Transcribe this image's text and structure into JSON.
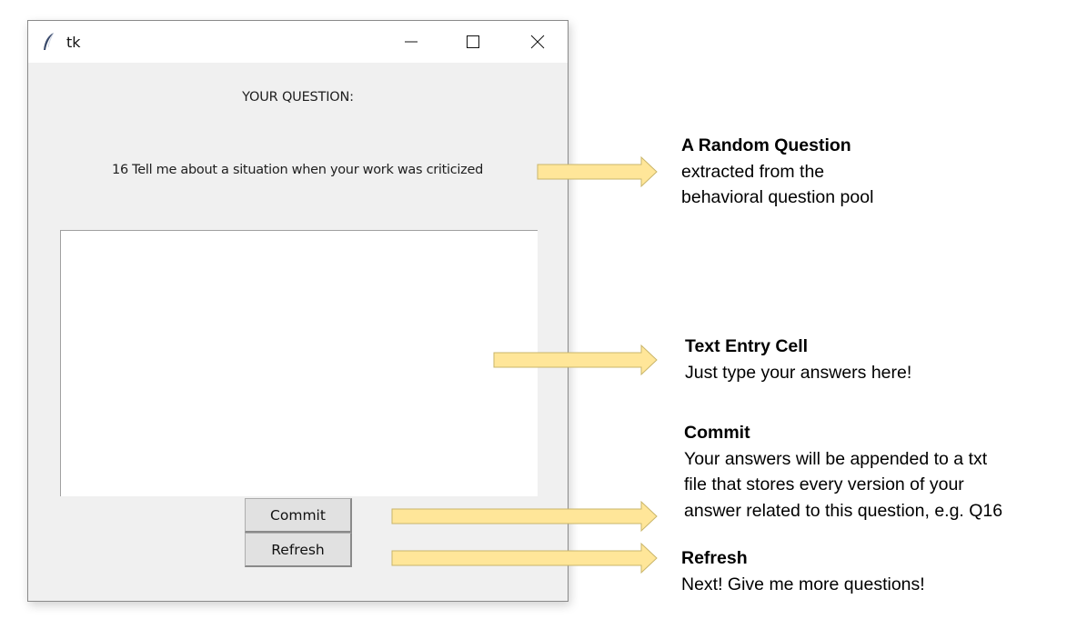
{
  "window": {
    "title": "tk",
    "controls": {
      "minimize": "minimize-icon",
      "maximize": "maximize-icon",
      "close": "close-icon"
    }
  },
  "app": {
    "heading": "YOUR QUESTION:",
    "question": "16 Tell me about a situation when your work was criticized",
    "answer_value": "",
    "commit_label": "Commit",
    "refresh_label": "Refresh"
  },
  "annotations": [
    {
      "title": "A Random Question",
      "body": "extracted from the\nbehavioral question pool"
    },
    {
      "title": "Text Entry Cell",
      "body": "Just type your answers here!"
    },
    {
      "title": "Commit",
      "body": "Your answers will be appended to a txt\nfile that stores every version of your\nanswer related to this question, e.g. Q16"
    },
    {
      "title": "Refresh",
      "body": "Next! Give me more questions!"
    }
  ],
  "colors": {
    "arrow_fill": "#ffe699",
    "arrow_stroke": "#c9b56a",
    "window_bg": "#f0f0f0"
  }
}
